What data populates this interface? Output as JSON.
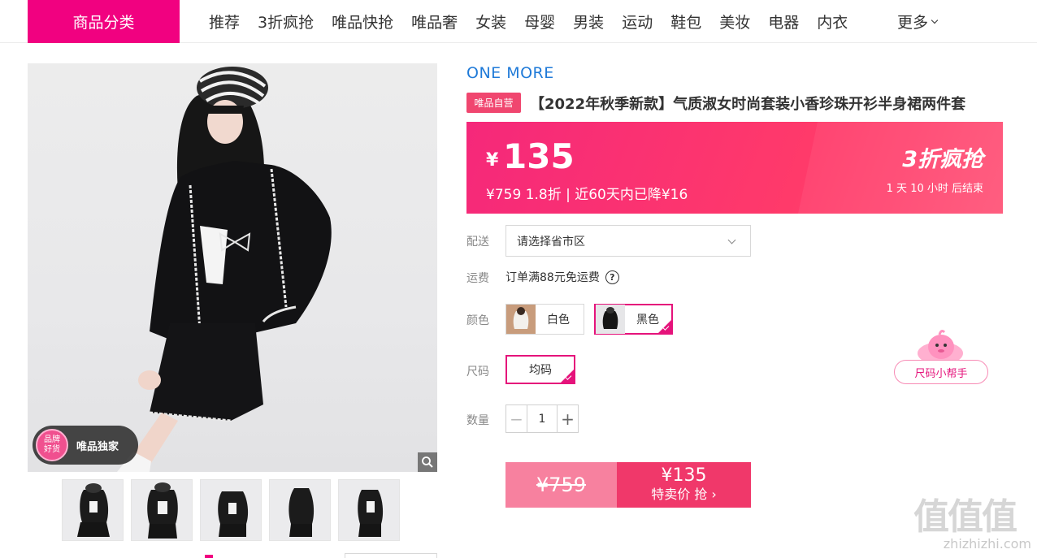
{
  "nav": {
    "category_label": "商品分类",
    "items": [
      "推荐",
      "3折疯抢",
      "唯品快抢",
      "唯品奢",
      "女装",
      "母婴",
      "男装",
      "运动",
      "鞋包",
      "美妆",
      "电器",
      "内衣"
    ],
    "more_label": "更多"
  },
  "gallery": {
    "exclusive_badge_circle_line1": "品牌",
    "exclusive_badge_circle_line2": "好货",
    "exclusive_badge_text": "唯品独家",
    "thumb_count": 5
  },
  "product": {
    "brand": "ONE MORE",
    "self_tag": "唯品自营",
    "title": "【2022年秋季新款】气质淑女时尚套装小香珍珠开衫半身裙两件套"
  },
  "price": {
    "currency": "¥",
    "current": "135",
    "sub_line": "¥759 1.8折 | 近60天内已降¥16",
    "promo_title": "3折疯抢",
    "promo_countdown": "1 天 10 小时 后结束"
  },
  "delivery": {
    "label": "配送",
    "placeholder": "请选择省市区"
  },
  "shipping": {
    "label": "运费",
    "text": "订单满88元免运费",
    "help_glyph": "?"
  },
  "color": {
    "label": "颜色",
    "options": [
      {
        "name": "白色",
        "selected": false
      },
      {
        "name": "黑色",
        "selected": true
      }
    ]
  },
  "size": {
    "label": "尺码",
    "options": [
      {
        "name": "均码",
        "selected": true
      }
    ],
    "helper_label": "尺码小帮手"
  },
  "quantity": {
    "label": "数量",
    "value": "1",
    "minus": "−",
    "plus": "+"
  },
  "buy": {
    "original_price": "¥759",
    "sale_price": "¥135",
    "action_label": "特卖价 抢",
    "arrow": "›"
  },
  "watermark": {
    "big": "值值值",
    "small": "zhizhizhi.com"
  },
  "colors": {
    "accent": "#f10180",
    "price_bg": "#f5287a",
    "brand_blue": "#1f7ad8",
    "selected_border": "#e5137b"
  }
}
